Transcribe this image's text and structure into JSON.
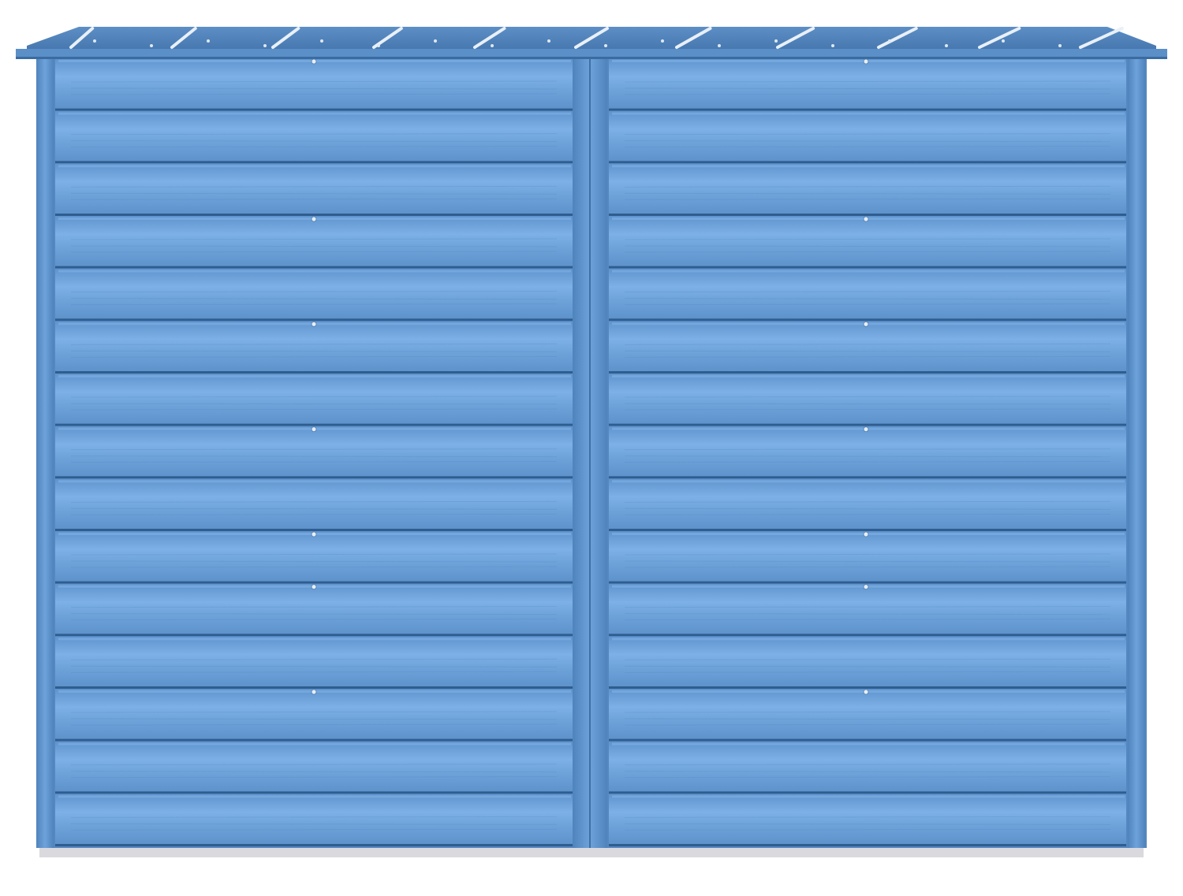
{
  "subject": {
    "name": "metal-storage-shed-back-view",
    "colors": {
      "panel": "#6a9fd6",
      "panel_highlight": "#7fb2e6",
      "panel_shadow": "#4f82bb",
      "seam": "#2f5d8f",
      "roof": "#4d7fb6",
      "roof_rib": "#e9f0f8",
      "trim": "#5a8fc8",
      "base": "#d9d9de"
    },
    "icons": [
      "screw-icon"
    ],
    "panel_count_per_side": 15,
    "sides": [
      "left-wall-panel",
      "right-wall-panel"
    ]
  }
}
